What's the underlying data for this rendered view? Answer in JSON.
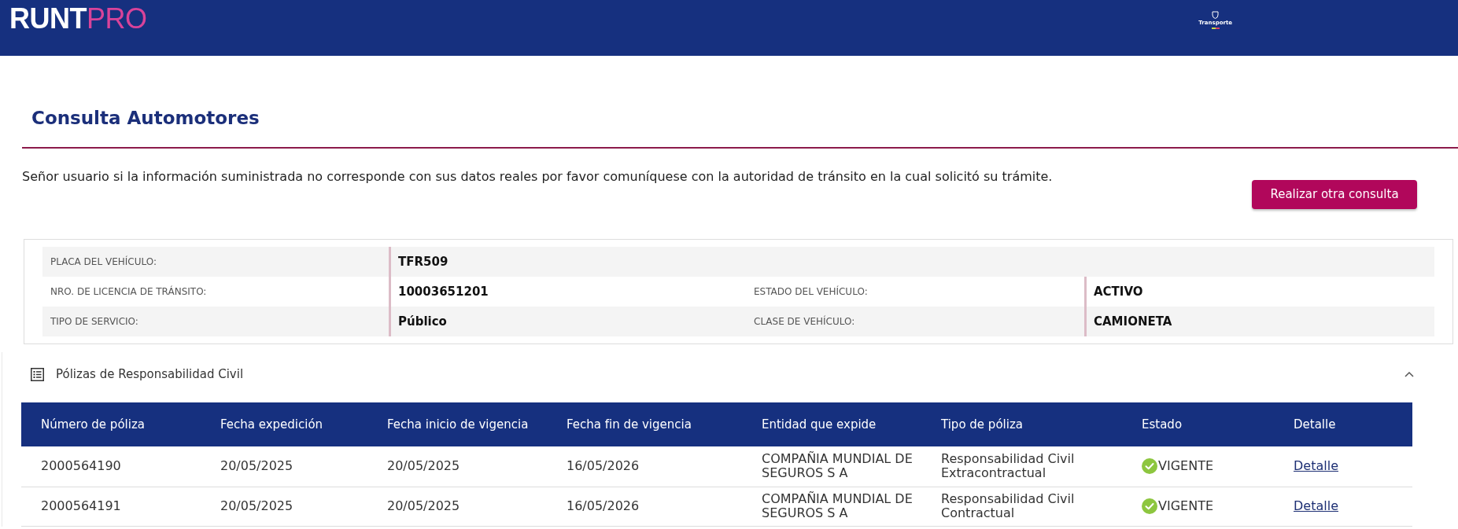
{
  "header": {
    "logo": {
      "primary": "RUNT",
      "accent": "PRO"
    },
    "partner_logo": {
      "text": "Transporte"
    }
  },
  "page": {
    "title": "Consulta Automotores",
    "notice": "Señor usuario si la información suministrada no corresponde con sus datos reales por favor comuníquese con la autoridad de tránsito en la cual solicitó su trámite.",
    "action_button": "Realizar otra consulta"
  },
  "vehicle_info": {
    "rows": [
      {
        "fields": [
          {
            "label": "PLACA DEL VEHÍCULO:",
            "value": "TFR509"
          }
        ]
      },
      {
        "fields": [
          {
            "label": "NRO. DE LICENCIA DE TRÁNSITO:",
            "value": "10003651201"
          },
          {
            "label": "ESTADO DEL VEHÍCULO:",
            "value": "ACTIVO"
          }
        ]
      },
      {
        "fields": [
          {
            "label": "TIPO DE SERVICIO:",
            "value": "Público"
          },
          {
            "label": "CLASE DE VEHÍCULO:",
            "value": "CAMIONETA"
          }
        ]
      }
    ]
  },
  "policies": {
    "title": "Pólizas de Responsabilidad Civil",
    "expanded": true,
    "table": {
      "columns": [
        "Número de póliza",
        "Fecha expedición",
        "Fecha inicio de vigencia",
        "Fecha fin de vigencia",
        "Entidad que expide",
        "Tipo de póliza",
        "Estado",
        "Detalle"
      ],
      "rows": [
        {
          "cells": [
            "2000564190",
            "20/05/2025",
            "20/05/2025",
            "16/05/2026",
            "COMPAÑIA MUNDIAL DE SEGUROS S A",
            "Responsabilidad Civil Extracontractual"
          ],
          "status": "VIGENTE",
          "detail_link": "Detalle"
        },
        {
          "cells": [
            "2000564191",
            "20/05/2025",
            "20/05/2025",
            "16/05/2026",
            "COMPAÑIA MUNDIAL DE SEGUROS S A",
            "Responsabilidad Civil Contractual"
          ],
          "status": "VIGENTE",
          "detail_link": "Detalle"
        }
      ]
    }
  }
}
